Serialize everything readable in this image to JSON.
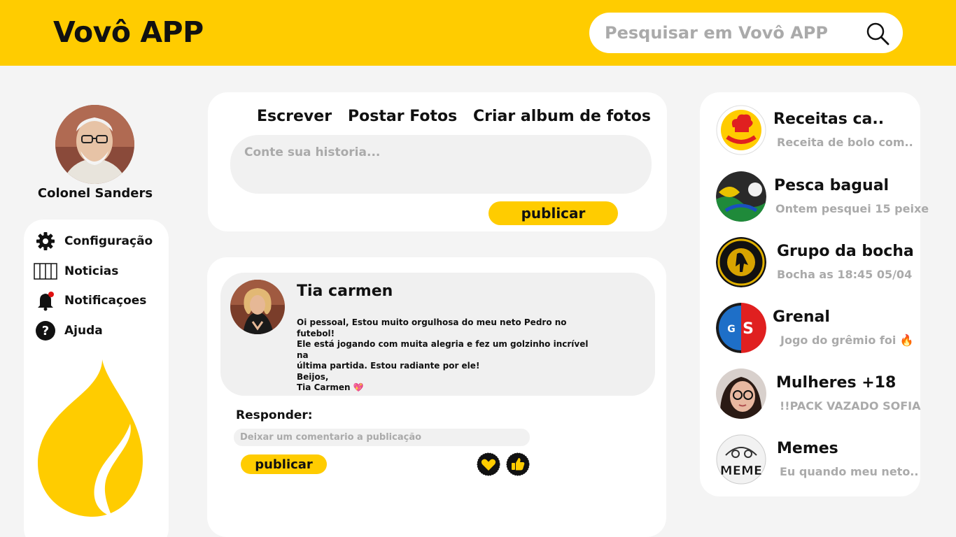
{
  "header": {
    "logo": "Vovô APP",
    "search_placeholder": "Pesquisar em Vovô APP"
  },
  "profile": {
    "name": "Colonel Sanders"
  },
  "menu": [
    {
      "label": "Configuração",
      "icon": "gear-icon"
    },
    {
      "label": "Noticias",
      "icon": "newspaper-icon"
    },
    {
      "label": "Notificaçoes",
      "icon": "bell-icon"
    },
    {
      "label": "Ajuda",
      "icon": "help-icon"
    }
  ],
  "compose": {
    "tabs": [
      "Escrever",
      "Postar Fotos",
      "Criar album de fotos"
    ],
    "placeholder": "Conte sua historia...",
    "publish_label": "publicar"
  },
  "post": {
    "author": "Tia carmen",
    "body": "Oi pessoal, Estou muito orgulhosa do meu neto Pedro no futebol!\nEle está jogando com muita alegria e fez um golzinho incrível na\núltima partida. Estou radiante por ele!\nBeijos,\nTia Carmen 💖",
    "reply_label": "Responder:",
    "reply_placeholder": "Deixar um comentario a publicação",
    "reply_publish_label": "publicar"
  },
  "groups": [
    {
      "name": "Receitas  ca..",
      "last": "Receita de bolo com..",
      "avatar": "cooking-group-logo"
    },
    {
      "name": "Pesca bagual",
      "last": "Ontem pesquei 15 peixe",
      "avatar": "fishing-group-logo"
    },
    {
      "name": "Grupo da bocha",
      "last": "Bocha as 18:45 05/04",
      "avatar": "bocha-group-logo"
    },
    {
      "name": "Grenal",
      "last": "Jogo do grêmio foi 🔥",
      "avatar": "grenal-logo"
    },
    {
      "name": "Mulheres +18",
      "last": "!!PACK VAZADO SOFIA",
      "avatar": "woman-photo"
    },
    {
      "name": "Memes",
      "last": "Eu quando meu neto..",
      "avatar": "meme-face"
    }
  ],
  "colors": {
    "accent": "#ffcc00",
    "background": "#f4f4f4",
    "muted_text": "#aaaaaa"
  }
}
